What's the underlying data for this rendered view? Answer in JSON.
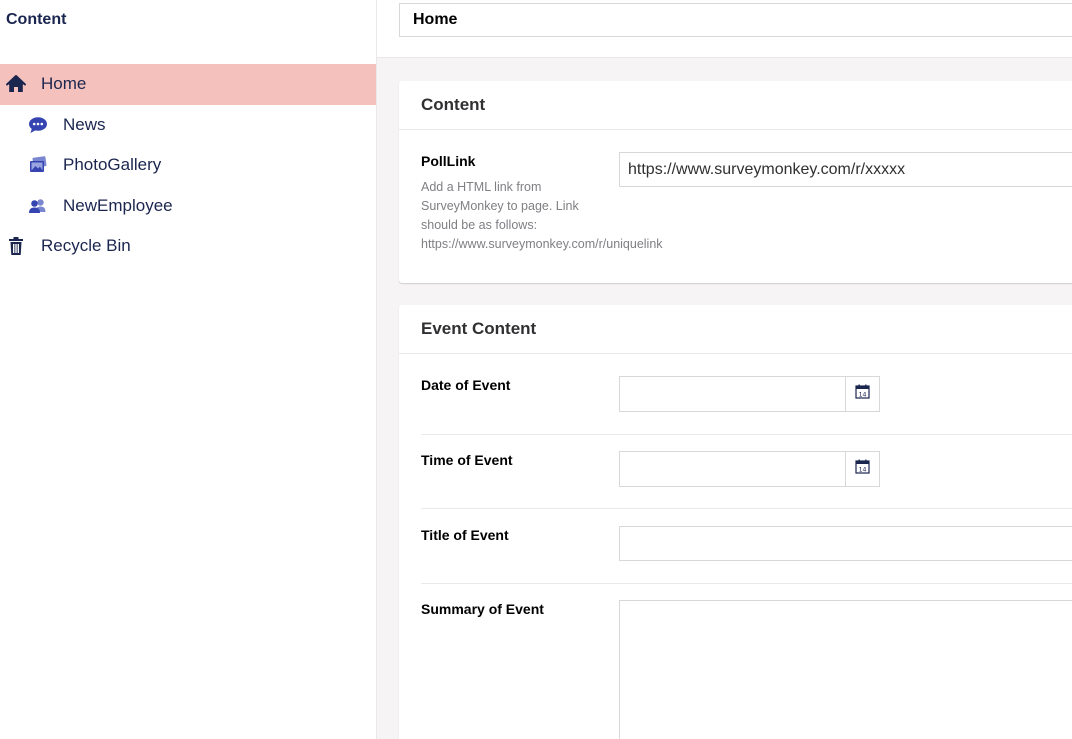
{
  "sidebar": {
    "title": "Content",
    "items": [
      {
        "label": "Home",
        "icon": "home-icon",
        "level": 0,
        "active": true
      },
      {
        "label": "News",
        "icon": "speech-bubble-icon",
        "level": 1
      },
      {
        "label": "PhotoGallery",
        "icon": "photo-stack-icon",
        "level": 1
      },
      {
        "label": "NewEmployee",
        "icon": "users-icon",
        "level": 1
      },
      {
        "label": "Recycle Bin",
        "icon": "trash-icon",
        "level": 0
      }
    ]
  },
  "header": {
    "name_value": "Home"
  },
  "content_panel": {
    "title": "Content",
    "poll_link": {
      "label": "PollLink",
      "description_lines": [
        "Add a HTML link from",
        "SurveyMonkey to page. Link",
        "should be as follows:",
        "https://www.surveymonkey.com/r/uniquelink"
      ],
      "value": "https://www.surveymonkey.com/r/xxxxx"
    }
  },
  "event_panel": {
    "title": "Event Content",
    "date_of_event": {
      "label": "Date of Event",
      "value": "",
      "icon": "calendar-icon"
    },
    "time_of_event": {
      "label": "Time of Event",
      "value": "",
      "icon": "calendar-icon"
    },
    "title_of_event": {
      "label": "Title of Event",
      "value": ""
    },
    "summary_of_event": {
      "label": "Summary of Event",
      "value": ""
    }
  },
  "colors": {
    "active_item_bg": "#f5c1bc",
    "icon_accent": "#3544b1",
    "navy_text": "#1b264f"
  }
}
